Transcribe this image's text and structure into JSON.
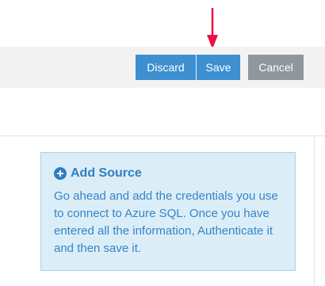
{
  "toolbar": {
    "discard_label": "Discard",
    "save_label": "Save",
    "cancel_label": "Cancel"
  },
  "info_box": {
    "icon": "plus-circle-icon",
    "title": "Add Source",
    "body": "Go ahead and add the credentials you use to connect to Azure SQL. Once you have entered all the information, Authenticate it and then save it."
  },
  "annotation": {
    "icon": "red-arrow-down-icon",
    "color": "#ee1144"
  },
  "colors": {
    "primary_button": "#3d8fd0",
    "cancel_button": "#8e979e",
    "info_background": "#dbeef8",
    "info_text": "#2e7fc1"
  }
}
